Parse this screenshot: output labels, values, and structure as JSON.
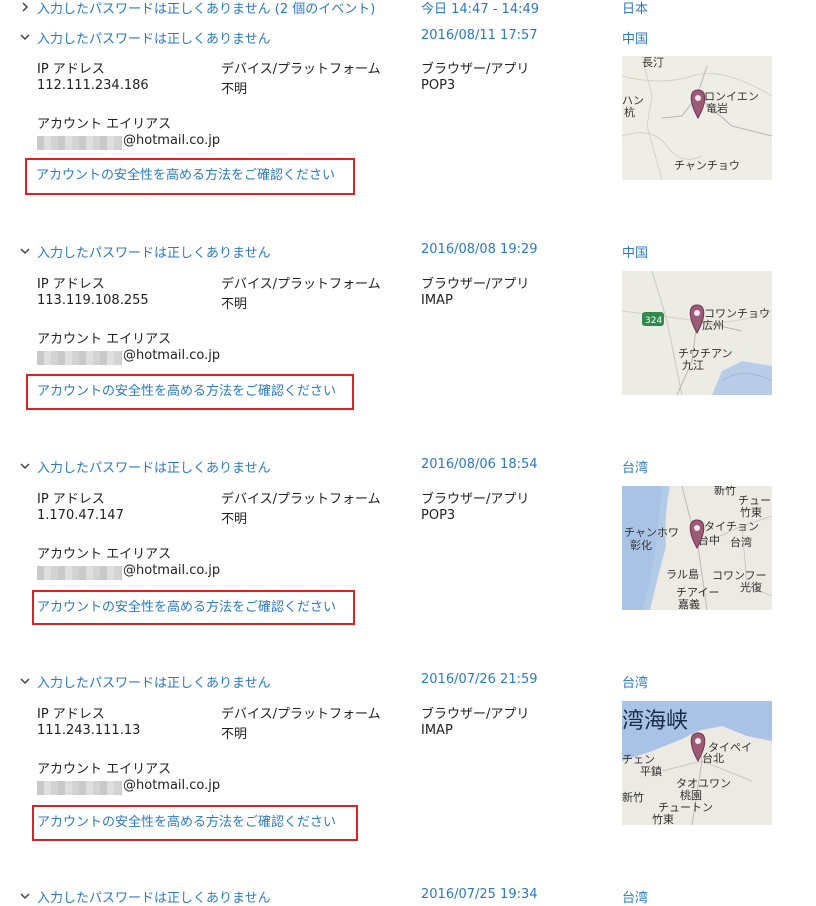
{
  "colors": {
    "link": "#2a7ac8",
    "highlight": "#e02020"
  },
  "labels": {
    "ip": "IP アドレス",
    "device": "デバイス/プラットフォーム",
    "browser": "ブラウザー/アプリ",
    "alias": "アカウント エイリアス",
    "secure_link": "アカウントの安全性を高める方法をご確認ください"
  },
  "top_row": {
    "title": "入力したパスワードは正しくありません (2 個のイベント)",
    "date": "今日 14:47 - 14:49",
    "country": "日本"
  },
  "events": [
    {
      "title": "入力したパスワードは正しくありません",
      "date": "2016/08/11 17:57",
      "country": "中国",
      "ip": "112.111.234.186",
      "device": "不明",
      "browser": "POP3",
      "alias_domain": "@hotmail.co.jp",
      "map_labels": [
        "長汀",
        "ロンイエン",
        "竜岩",
        "ハン",
        "杭",
        "チャンチョウ"
      ]
    },
    {
      "title": "入力したパスワードは正しくありません",
      "date": "2016/08/08 19:29",
      "country": "中国",
      "ip": "113.119.108.255",
      "device": "不明",
      "browser": "IMAP",
      "alias_domain": "@hotmail.co.jp",
      "map_labels": [
        "コワンチョウ",
        "広州",
        "チウチアン",
        "九江",
        "324"
      ]
    },
    {
      "title": "入力したパスワードは正しくありません",
      "date": "2016/08/06 18:54",
      "country": "台湾",
      "ip": "1.170.47.147",
      "device": "不明",
      "browser": "POP3",
      "alias_domain": "@hotmail.co.jp",
      "map_labels": [
        "新竹",
        "チュー",
        "竹東",
        "チャンホワ",
        "彰化",
        "タイチョン",
        "台中",
        "台湾",
        "コワンフー",
        "光復",
        "ラル島",
        "チアイー",
        "嘉義"
      ]
    },
    {
      "title": "入力したパスワードは正しくありません",
      "date": "2016/07/26 21:59",
      "country": "台湾",
      "ip": "111.243.111.13",
      "device": "不明",
      "browser": "IMAP",
      "alias_domain": "@hotmail.co.jp",
      "map_labels": [
        "湾海峡",
        "タイペイ",
        "台北",
        "チェン",
        "平鎮",
        "タオユワン",
        "桃園",
        "新竹",
        "チュートン",
        "竹東"
      ]
    }
  ],
  "bottom_row": {
    "title": "入力したパスワードは正しくありません",
    "date": "2016/07/25 19:34",
    "country": "台湾"
  }
}
